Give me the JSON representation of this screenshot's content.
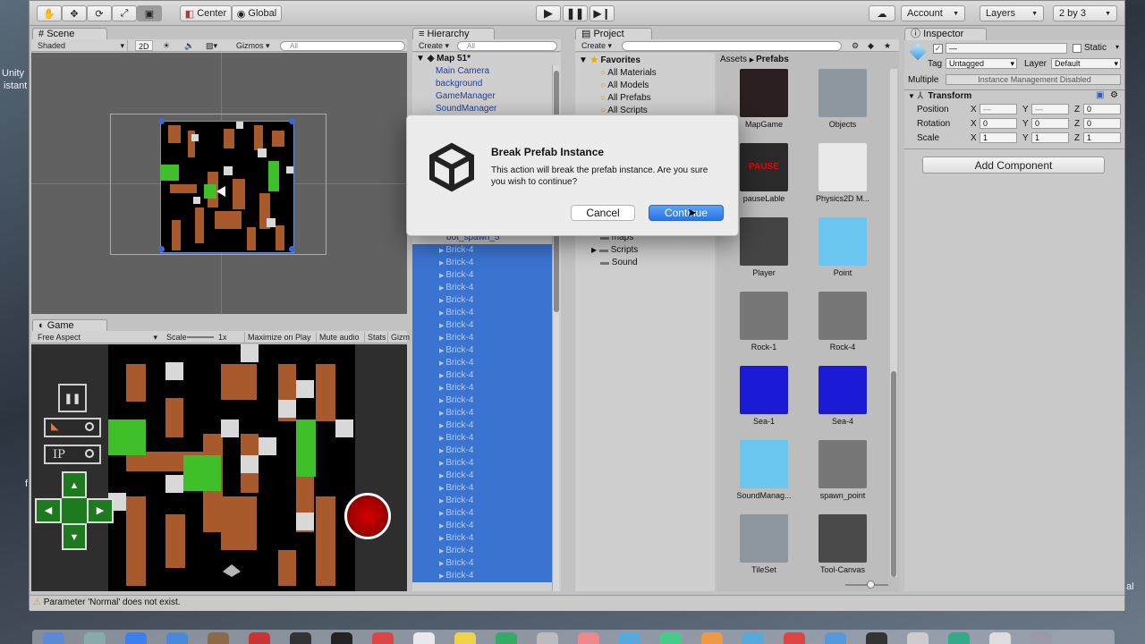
{
  "desktop": {
    "left_text": [
      "Unity",
      "istant"
    ],
    "right_text": "al",
    "left_fragment": "f"
  },
  "toolbar": {
    "pivot": "Center",
    "space": "Global",
    "account": "Account",
    "layers": "Layers",
    "layout": "2 by 3"
  },
  "scene": {
    "tab": "Scene",
    "shading": "Shaded",
    "mode_2d": "2D",
    "gizmos": "Gizmos",
    "search_placeholder": "All"
  },
  "game": {
    "tab": "Game",
    "aspect": "Free Aspect",
    "scale_label": "Scale",
    "scale_value": "1x",
    "maximize": "Maximize on Play",
    "mute": "Mute audio",
    "stats": "Stats",
    "gizmos": "Gizm",
    "ip_label": "IP"
  },
  "hierarchy": {
    "tab": "Hierarchy",
    "create": "Create",
    "search_placeholder": "All",
    "scene_name": "Map 51*",
    "items": [
      "Main Camera",
      "background",
      "GameManager",
      "SoundManager"
    ],
    "partial_item": "bot_spawn_5",
    "brick_label": "Brick-4",
    "brick_count": 27
  },
  "project": {
    "tab": "Project",
    "create": "Create",
    "favorites": "Favorites",
    "favorite_items": [
      "All Materials",
      "All Models",
      "All Prefabs",
      "All Scripts"
    ],
    "folders": [
      "maps",
      "Scripts",
      "Sound"
    ],
    "breadcrumb": [
      "Assets",
      "Prefabs"
    ],
    "assets": [
      "MapGame",
      "Objects",
      "pauseLable",
      "Physics2D M...",
      "Player",
      "Point",
      "Rock-1",
      "Rock-4",
      "Sea-1",
      "Sea-4",
      "SoundManag...",
      "spawn_point",
      "TileSet",
      "Tool-Canvas"
    ],
    "pause_text": "PAUSE"
  },
  "inspector": {
    "tab": "Inspector",
    "static_label": "Static",
    "name_placeholder": "—",
    "tag_label": "Tag",
    "tag_value": "Untagged",
    "layer_label": "Layer",
    "layer_value": "Default",
    "multiple_label": "Multiple",
    "multiple_value": "Instance Management Disabled",
    "transform_label": "Transform",
    "position_label": "Position",
    "rotation_label": "Rotation",
    "scale_label": "Scale",
    "axis_x": "X",
    "axis_y": "Y",
    "axis_z": "Z",
    "position": [
      "—",
      "—",
      "0"
    ],
    "rotation": [
      "0",
      "0",
      "0"
    ],
    "scale": [
      "1",
      "1",
      "1"
    ],
    "add_component": "Add Component"
  },
  "dialog": {
    "title": "Break Prefab Instance",
    "message": "This action will break the prefab instance. Are you sure you wish to continue?",
    "cancel": "Cancel",
    "continue": "Continue"
  },
  "status": {
    "message": "Parameter 'Normal' does not exist."
  },
  "colors": {
    "accent": "#3a73d0",
    "brick": "#a85a2c",
    "grass": "#3fbf2a",
    "steel": "#cfcfcf"
  }
}
